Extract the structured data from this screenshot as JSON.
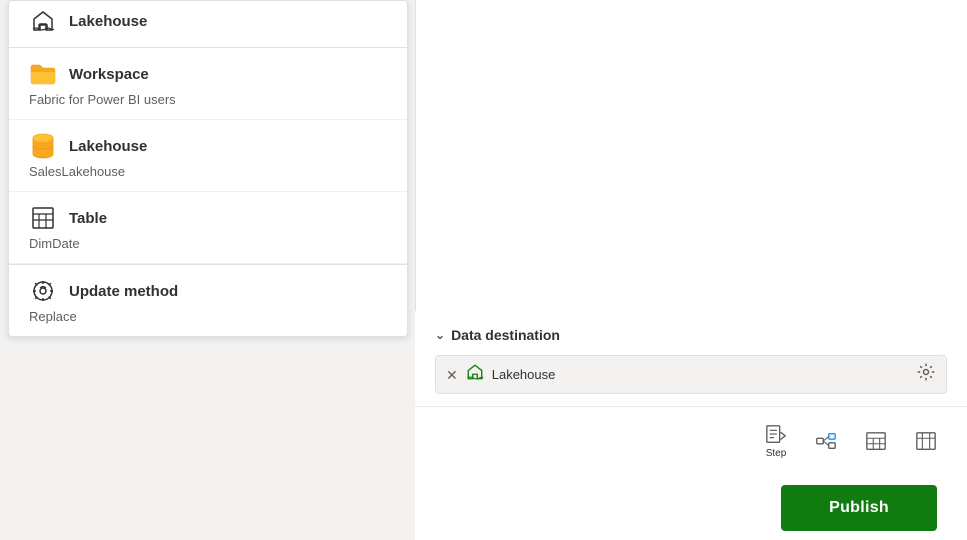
{
  "dropdown": {
    "items": [
      {
        "id": "lakehouse-top",
        "icon": "lakehouse",
        "title": "Lakehouse",
        "subtitle": null,
        "partial": true
      },
      {
        "id": "workspace",
        "icon": "workspace",
        "title": "Workspace",
        "subtitle": "Fabric for Power BI users"
      },
      {
        "id": "lakehouse-main",
        "icon": "lakehouse-db",
        "title": "Lakehouse",
        "subtitle": "SalesLakehouse"
      },
      {
        "id": "table",
        "icon": "table",
        "title": "Table",
        "subtitle": "DimDate"
      },
      {
        "id": "update-method",
        "icon": "update-method",
        "title": "Update method",
        "subtitle": "Replace"
      }
    ]
  },
  "data_destination": {
    "header": "Data destination",
    "destination_label": "Lakehouse",
    "chevron": "∨"
  },
  "toolbar": {
    "step_label": "Step",
    "publish_label": "Publish"
  }
}
